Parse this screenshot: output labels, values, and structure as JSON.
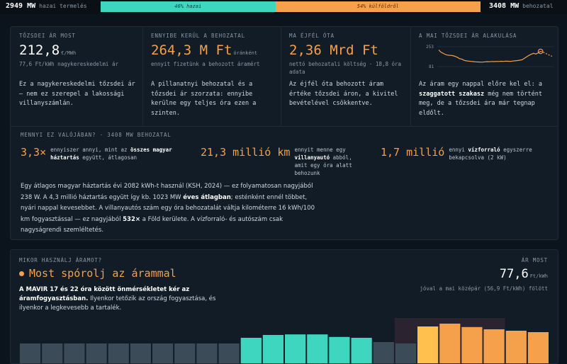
{
  "topbar": {
    "domestic_value": "2949 MW",
    "domestic_label": "hazai termelés",
    "domestic_share_label": "46% hazai",
    "domestic_share": 0.46,
    "import_share_label": "54% külföldről",
    "import_share": 0.54,
    "import_value": "3408 MW",
    "import_label": "behozatal"
  },
  "cards": {
    "spot": {
      "label": "TŐZSDEI ÁR MOST",
      "value": "212,8",
      "unit": "€/MWh",
      "sub": "77,6 Ft/kWh nagykereskedelmi ár",
      "text_1": "Ez a nagykereskedelmi tőzsdei ár — nem ez szerepel a lakossági villanyszámlán."
    },
    "hourly": {
      "label": "ENNYIBE KERÜL A BEHOZATAL",
      "value": "264,3 M Ft",
      "unit": "óránként",
      "sub": "ennyit fizetünk a behozott áramért",
      "text_1": "A pillanatnyi behozatal és a tőzsdei ár szorzata: ennyibe kerülne egy teljes óra ezen a szinten."
    },
    "midnight": {
      "label": "MA ÉJFÉL ÓTA",
      "value": "2,36 Mrd Ft",
      "sub": "nettó behozatali költség · 18,8 óra adata",
      "text_1": "Az éjfél óta behozott áram értéke tőzsdei áron, a kivitel bevételével csökkentve."
    },
    "trend": {
      "label": "A MAI TŐZSDEI ÁR ALAKULÁSA",
      "tick_high": "253",
      "tick_low": "81",
      "text_a": "Az áram egy nappal előre kel el: a ",
      "text_b": "szaggatott szakasz",
      "text_c": " még nem történt meg, de a tőzsdei ára már tegnap eldőlt."
    }
  },
  "chart_data": {
    "type": "line",
    "title": "A MAI TŐZSDEI ÁR ALAKULÁSA",
    "unit": "€/MWh",
    "ylim": [
      81,
      253
    ],
    "y_ticks": [
      "253",
      "81"
    ],
    "series": [
      {
        "values": [
          225,
          205,
          195,
          185,
          180,
          178,
          176,
          170,
          162,
          150,
          145,
          135,
          130,
          128,
          126,
          124,
          122,
          121,
          120,
          120,
          122,
          124,
          123,
          125,
          124,
          126,
          125,
          127,
          126,
          128,
          127,
          126,
          129,
          131,
          133,
          136,
          140,
          152,
          166,
          178,
          188,
          196,
          190,
          200,
          212.8
        ]
      },
      {
        "dashed": true,
        "values": [
          212.8,
          208,
          196,
          188,
          178,
          170
        ]
      }
    ],
    "marker_index": 44,
    "colors": {
      "line": "#f5a04a"
    }
  },
  "equivalents": {
    "label": "MENNYI EZ VALÓJÁBAN? · 3408 MW BEHOZATAL",
    "households": {
      "value": "3,3×",
      "desc_a": "ennyiszer annyi, mint az ",
      "desc_b": "összes magyar háztartás",
      "desc_c": " együtt, átlagosan"
    },
    "cars": {
      "value": "21,3 millió km",
      "desc_a": "ennyit menne egy ",
      "desc_b": "villanyautó",
      "desc_c": " abból, amit egy óra alatt behozunk"
    },
    "kettles": {
      "value": "1,7 millió",
      "desc_a": "ennyi ",
      "desc_b": "vízforraló",
      "desc_c": " egyszerre bekapcsolva (2 kW)"
    }
  },
  "explanation": {
    "p1": "Egy átlagos magyar háztartás évi 2082 kWh-t használ (KSH, 2024) — ez folyamatosan nagyjából 238 W. A 4,3 millió háztartás együtt így kb. 1023 MW ",
    "p1_b": "éves átlagban",
    "p2": "; esténként ennél többet, nyári nappal kevesebbet. A villanyautós szám egy óra behozatalát váltja kilométerre 16 kWh/100 km fogyasztással — ez nagyjából ",
    "p2_b": "532×",
    "p3": " a Föld kerülete. A vízforraló- és autószám csak nagyságrendi szemléltetés."
  },
  "when": {
    "label": "MIKOR HASZNÁLJ ÁRAMOT?",
    "title": "Most spórolj az árammal",
    "text_b": "A MAVIR 17 és 22 óra között önmérsékletet kér az áramfogyasztásban.",
    "text_rest": " Ilyenkor tetőzik az ország fogyasztása, és ilyenkor a legkevesebb a tartalék.",
    "now_label": "ÁR MOST",
    "now_value": "77,6",
    "now_unit": "Ft/kWh",
    "now_sub": "jóval a mai középár (56,9 Ft/kWh) fölött",
    "hours": [
      0.05,
      0.05,
      0.04,
      0.04,
      0.05,
      0.05,
      0.07,
      0.08,
      0.07,
      0.08,
      0.3,
      0.4,
      0.42,
      0.42,
      0.33,
      0.3,
      0.15,
      0.1,
      0.7,
      0.8,
      0.68,
      0.6,
      0.55,
      0.5
    ],
    "current_hour": 18,
    "mavir_hours": [
      17,
      18,
      19,
      20,
      21
    ],
    "colors": {
      "low": "#3b4b58",
      "mid": "#3fd6c0",
      "high": "#f5a04a",
      "now": "#ffc04d",
      "mavir_band": "#2c2330"
    }
  }
}
